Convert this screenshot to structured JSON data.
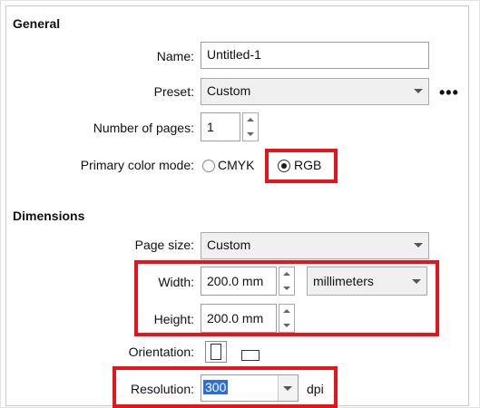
{
  "general": {
    "section_title": "General",
    "name_label": "Name:",
    "name_value": "Untitled-1",
    "preset_label": "Preset:",
    "preset_value": "Custom",
    "more_label": "•••",
    "pages_label": "Number of pages:",
    "pages_value": "1",
    "color_label": "Primary color mode:",
    "color_options": [
      "CMYK",
      "RGB"
    ],
    "color_selected": "RGB"
  },
  "dimensions": {
    "section_title": "Dimensions",
    "page_size_label": "Page size:",
    "page_size_value": "Custom",
    "width_label": "Width:",
    "width_value": "200.0 mm",
    "units_value": "millimeters",
    "height_label": "Height:",
    "height_value": "200.0 mm",
    "orientation_label": "Orientation:",
    "resolution_label": "Resolution:",
    "resolution_value": "300",
    "resolution_unit": "dpi"
  },
  "colors": {
    "highlight": "#e8141c",
    "selection": "#2f6fd1"
  },
  "icons": [
    "portrait-orientation-icon",
    "landscape-orientation-icon",
    "more-options-icon",
    "dropdown-arrow-icon",
    "spinner-icon"
  ]
}
